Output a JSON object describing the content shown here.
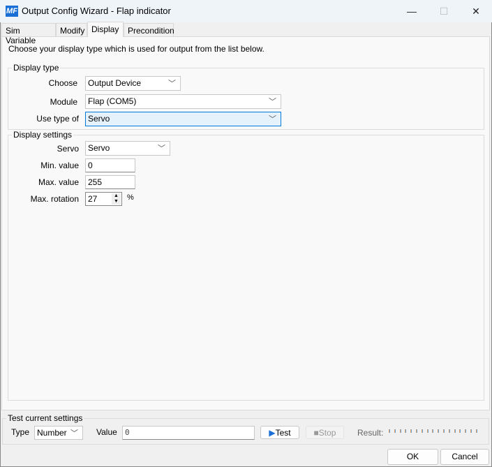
{
  "window": {
    "title": "Output Config Wizard - Flap indicator",
    "logo": "MF",
    "minimize": "—",
    "maximize": "☐",
    "close": "✕"
  },
  "tabs": [
    {
      "label": "Sim Variable"
    },
    {
      "label": "Modify"
    },
    {
      "label": "Display",
      "active": true
    },
    {
      "label": "Precondition"
    }
  ],
  "intro": "Choose your display type which is used for output from the list below.",
  "display_type": {
    "legend": "Display type",
    "choose_label": "Choose",
    "choose_value": "Output Device",
    "module_label": "Module",
    "module_value": "Flap (COM5)",
    "use_type_label": "Use type of",
    "use_type_value": "Servo"
  },
  "display_settings": {
    "legend": "Display settings",
    "servo_label": "Servo",
    "servo_value": "Servo",
    "min_label": "Min. value",
    "min_value": "0",
    "max_label": "Max. value",
    "max_value": "255",
    "rotation_label": "Max. rotation",
    "rotation_value": "27",
    "rotation_unit": "%"
  },
  "test": {
    "legend": "Test current settings",
    "type_label": "Type",
    "type_value": "Number",
    "value_label": "Value",
    "value": "0",
    "test_button": "Test",
    "stop_button": "Stop",
    "result_label": "Result:"
  },
  "footer": {
    "ok": "OK",
    "cancel": "Cancel"
  },
  "colors": {
    "accent": "#0078d7",
    "focus_bg": "#e5f1fb",
    "result_ticks": [
      "#e0a060",
      "#6a9fd8"
    ]
  }
}
